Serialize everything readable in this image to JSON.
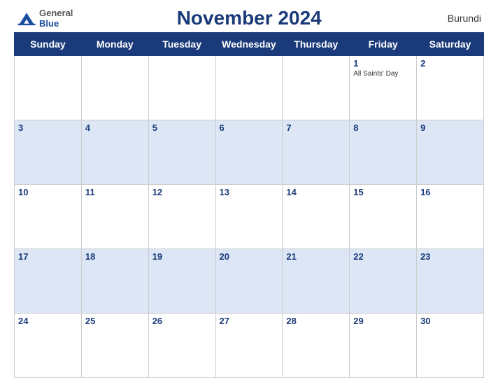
{
  "header": {
    "title": "November 2024",
    "country": "Burundi",
    "logo": {
      "general": "General",
      "blue": "Blue"
    }
  },
  "days_of_week": [
    "Sunday",
    "Monday",
    "Tuesday",
    "Wednesday",
    "Thursday",
    "Friday",
    "Saturday"
  ],
  "weeks": [
    [
      {
        "date": "",
        "event": ""
      },
      {
        "date": "",
        "event": ""
      },
      {
        "date": "",
        "event": ""
      },
      {
        "date": "",
        "event": ""
      },
      {
        "date": "",
        "event": ""
      },
      {
        "date": "1",
        "event": "All Saints' Day"
      },
      {
        "date": "2",
        "event": ""
      }
    ],
    [
      {
        "date": "3",
        "event": ""
      },
      {
        "date": "4",
        "event": ""
      },
      {
        "date": "5",
        "event": ""
      },
      {
        "date": "6",
        "event": ""
      },
      {
        "date": "7",
        "event": ""
      },
      {
        "date": "8",
        "event": ""
      },
      {
        "date": "9",
        "event": ""
      }
    ],
    [
      {
        "date": "10",
        "event": ""
      },
      {
        "date": "11",
        "event": ""
      },
      {
        "date": "12",
        "event": ""
      },
      {
        "date": "13",
        "event": ""
      },
      {
        "date": "14",
        "event": ""
      },
      {
        "date": "15",
        "event": ""
      },
      {
        "date": "16",
        "event": ""
      }
    ],
    [
      {
        "date": "17",
        "event": ""
      },
      {
        "date": "18",
        "event": ""
      },
      {
        "date": "19",
        "event": ""
      },
      {
        "date": "20",
        "event": ""
      },
      {
        "date": "21",
        "event": ""
      },
      {
        "date": "22",
        "event": ""
      },
      {
        "date": "23",
        "event": ""
      }
    ],
    [
      {
        "date": "24",
        "event": ""
      },
      {
        "date": "25",
        "event": ""
      },
      {
        "date": "26",
        "event": ""
      },
      {
        "date": "27",
        "event": ""
      },
      {
        "date": "28",
        "event": ""
      },
      {
        "date": "29",
        "event": ""
      },
      {
        "date": "30",
        "event": ""
      }
    ]
  ]
}
